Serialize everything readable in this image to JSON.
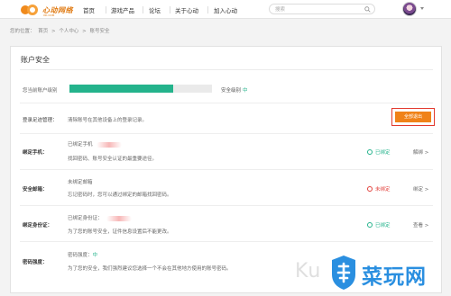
{
  "header": {
    "logo_text": "心动网络",
    "logo_sub": "XD.COM",
    "nav": [
      "首页",
      "游戏产品",
      "论坛",
      "关于心动",
      "加入心动"
    ],
    "search_placeholder": "搜索"
  },
  "breadcrumb": {
    "prefix": "您的位置：",
    "items": [
      "首页",
      ">",
      "个人中心",
      ">",
      "账号安全"
    ]
  },
  "panel": {
    "title": "账户安全",
    "level": {
      "label": "您当前账户级别",
      "progress_percent": 73,
      "text": "安全级别",
      "value": "中"
    },
    "login_mgmt": {
      "label": "登录足迹管理：",
      "text": "清除账号在其他设备上的登录记录。",
      "button": "全部退出"
    },
    "rows": [
      {
        "label": "绑定手机：",
        "line1": "已绑定手机",
        "line2": "找回密码、账号安全认证的最重要途径。",
        "status": "已绑定",
        "action": "解绑 >"
      },
      {
        "label": "安全邮箱：",
        "line1": "未绑定邮箱",
        "line2": "忘记密码时，您可以通过绑定的邮箱找回密码。",
        "status": "未绑定",
        "action": "绑定 >"
      },
      {
        "label": "绑定身份证：",
        "line1": "已绑定身份证：",
        "line2": "为了您的账号安全，证件信息设置后不能更改。",
        "status": "已绑定",
        "action": "查看 >"
      }
    ],
    "password": {
      "label": "密码强度：",
      "line1_prefix": "密码强度：",
      "line1_value": "中",
      "line2": "为了您的安全，我们强烈建议您选择一个不会在其他地方使用的账号密码。"
    }
  },
  "watermark": {
    "ku": "Ku",
    "text": "菜玩网"
  },
  "colors": {
    "accent_green": "#24b38c",
    "orange_button": "#f08218",
    "warning_red": "#e2413c",
    "highlight_frame": "#e23a2e",
    "logo_orange": "#f08a1c"
  }
}
